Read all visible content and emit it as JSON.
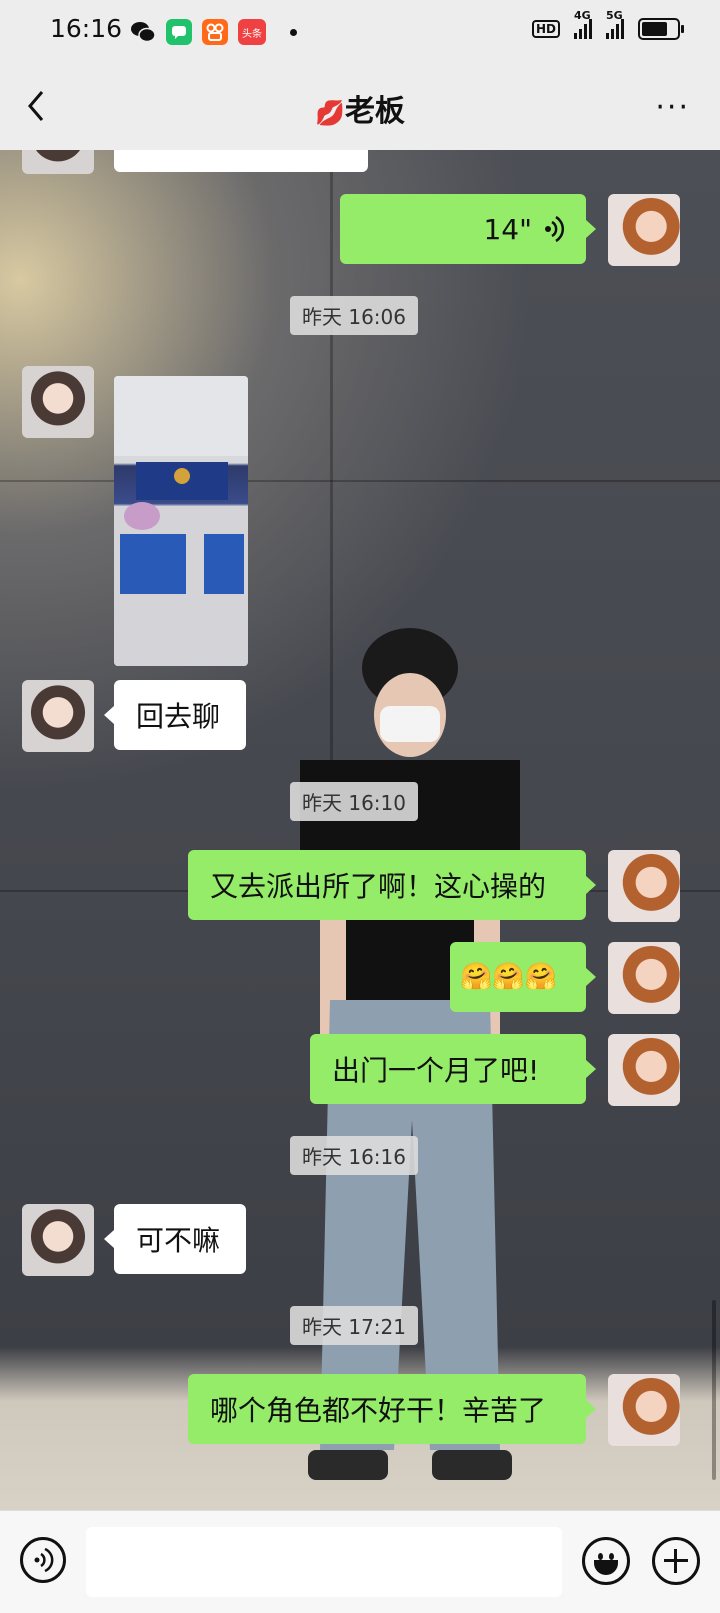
{
  "status_bar": {
    "time": "16:16",
    "apps": [
      "wechat-icon",
      "chat-icon",
      "kuaishou-icon",
      "toutiao-icon"
    ],
    "toutiao_label": "头条",
    "hd_label": "HD",
    "net_4g": "4G",
    "net_5g": "5G",
    "battery_level": 0.75
  },
  "nav": {
    "title": "老板",
    "title_emoji": "💋",
    "more": "···"
  },
  "messages": {
    "voice_duration": "14\"",
    "time1": "昨天 16:06",
    "msg_huiqu": "回去聊",
    "time2": "昨天 16:10",
    "msg_paichusuo": "又去派出所了啊！这心操的",
    "msg_emoji": "🤗🤗🤗",
    "msg_chumen": "出门一个月了吧!",
    "time3": "昨天 16:16",
    "msg_kebuma": "可不嘛",
    "time4": "昨天 17:21",
    "msg_jiaose": "哪个角色都不好干！辛苦了"
  },
  "input": {
    "placeholder": ""
  },
  "colors": {
    "sent_bubble": "#95ec69",
    "received_bubble": "#ffffff",
    "bar_bg": "#ededed"
  }
}
